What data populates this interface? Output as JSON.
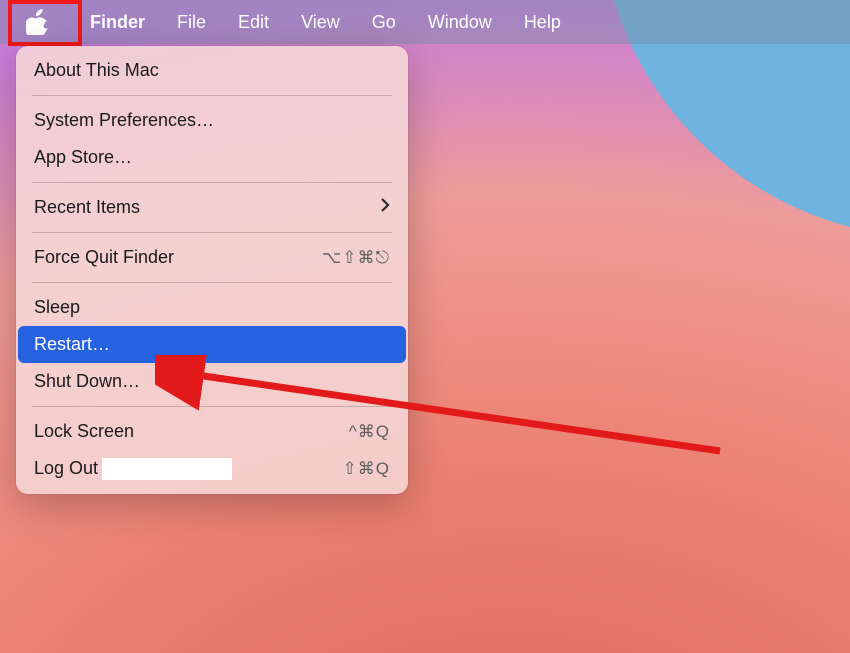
{
  "menubar": {
    "app_name": "Finder",
    "items": [
      "File",
      "Edit",
      "View",
      "Go",
      "Window",
      "Help"
    ]
  },
  "apple_menu": {
    "about": "About This Mac",
    "system_prefs": "System Preferences…",
    "app_store": "App Store…",
    "recent_items": "Recent Items",
    "force_quit": "Force Quit Finder",
    "force_quit_shortcut": "⌥⇧⌘⎋",
    "sleep": "Sleep",
    "restart": "Restart…",
    "shut_down": "Shut Down…",
    "lock_screen": "Lock Screen",
    "lock_screen_shortcut": "^⌘Q",
    "log_out": "Log Out",
    "log_out_shortcut": "⇧⌘Q"
  },
  "annotation": {
    "arrow_color": "#e21a1a",
    "highlight_color": "#f01818"
  }
}
